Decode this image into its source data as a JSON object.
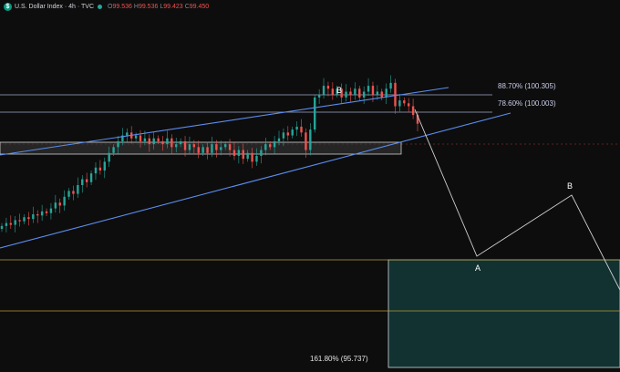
{
  "header": {
    "icon_glyph": "$",
    "title": "U.S. Dollar Index · 4h · TVC",
    "ohlc": [
      {
        "label": "O",
        "value": "99.536"
      },
      {
        "label": "H",
        "value": "99.536"
      },
      {
        "label": "L",
        "value": "99.423"
      },
      {
        "label": "C",
        "value": "99.450"
      }
    ]
  },
  "levels": {
    "fib_887": "88.70% (100.305)",
    "fib_786": "78.60% (100.003)",
    "fib_1618": "161.80% (95.737)"
  },
  "wave_labels": {
    "b_top": "B",
    "a_proj": "A",
    "b_proj": "B"
  },
  "colors": {
    "background": "#0d0d0d",
    "up": "#26a69a",
    "down": "#ef5350",
    "trendline": "#5b8def",
    "fib_line": "#9fa8c8",
    "target_fill": "#123131",
    "yellow_line": "#b39d3a",
    "projection": "#d0d0d0"
  },
  "chart_data": {
    "type": "candlestick",
    "symbol": "U.S. Dollar Index",
    "timeframe": "4h",
    "source": "TVC",
    "ohlc_last": {
      "open": 99.536,
      "high": 99.536,
      "low": 99.423,
      "close": 99.45
    },
    "ylim": [
      95.2,
      101.35
    ],
    "levels": [
      {
        "label": "88.70%",
        "price": 100.305
      },
      {
        "label": "78.60%",
        "price": 100.003
      },
      {
        "label": "161.80%",
        "price": 95.737
      }
    ],
    "candles_close": [
      97.7,
      97.75,
      97.72,
      97.8,
      97.78,
      97.85,
      97.82,
      97.9,
      97.88,
      97.95,
      97.92,
      98.0,
      98.1,
      98.05,
      98.2,
      98.3,
      98.25,
      98.4,
      98.5,
      98.45,
      98.6,
      98.7,
      98.65,
      98.8,
      98.95,
      99.05,
      99.15,
      99.25,
      99.3,
      99.2,
      99.25,
      99.15,
      99.2,
      99.1,
      99.2,
      99.15,
      99.1,
      99.2,
      99.05,
      99.1,
      99.15,
      99.0,
      99.1,
      99.05,
      98.95,
      99.05,
      98.95,
      99.1,
      99.0,
      99.05,
      99.1,
      99.0,
      98.9,
      99.0,
      98.85,
      98.95,
      98.8,
      98.9,
      99.0,
      99.1,
      99.05,
      99.15,
      99.2,
      99.3,
      99.25,
      99.35,
      99.4,
      99.3,
      99.0,
      99.35,
      99.9,
      99.95,
      100.1,
      100.05,
      99.95,
      100.05,
      99.9,
      100.0,
      99.95,
      100.05,
      99.9,
      100.0,
      100.1,
      99.95,
      100.0,
      99.9,
      100.05,
      100.15,
      99.75,
      99.85,
      99.8,
      99.75,
      99.6,
      99.45
    ]
  }
}
